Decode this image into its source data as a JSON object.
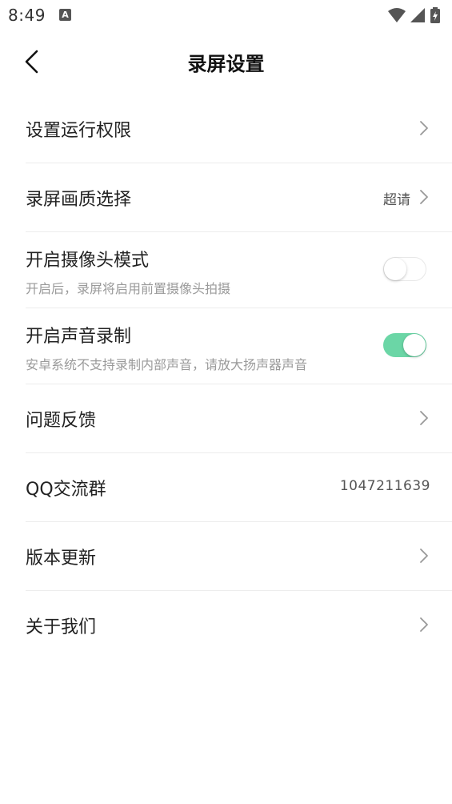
{
  "status_bar": {
    "time": "8:49",
    "notification_icon": "A",
    "icons": [
      "wifi-icon",
      "signal-icon",
      "battery-charging-icon"
    ]
  },
  "header": {
    "back_icon": "chevron-left-icon",
    "title": "录屏设置"
  },
  "settings": {
    "run_permission": {
      "title": "设置运行权限"
    },
    "quality": {
      "title": "录屏画质选择",
      "value": "超请"
    },
    "camera": {
      "title": "开启摄像头模式",
      "subtitle": "开启后，录屏将启用前置摄像头拍摄",
      "enabled": false
    },
    "audio": {
      "title": "开启声音录制",
      "subtitle": "安卓系统不支持录制内部声音，请放大扬声器声音",
      "enabled": true
    },
    "feedback": {
      "title": "问题反馈"
    },
    "qq_group": {
      "title": "QQ交流群",
      "value": "1047211639"
    },
    "update": {
      "title": "版本更新"
    },
    "about": {
      "title": "关于我们"
    }
  },
  "colors": {
    "toggle_on": "#6bd6a6",
    "divider": "#ececec",
    "subtitle": "#9a9a9a"
  }
}
